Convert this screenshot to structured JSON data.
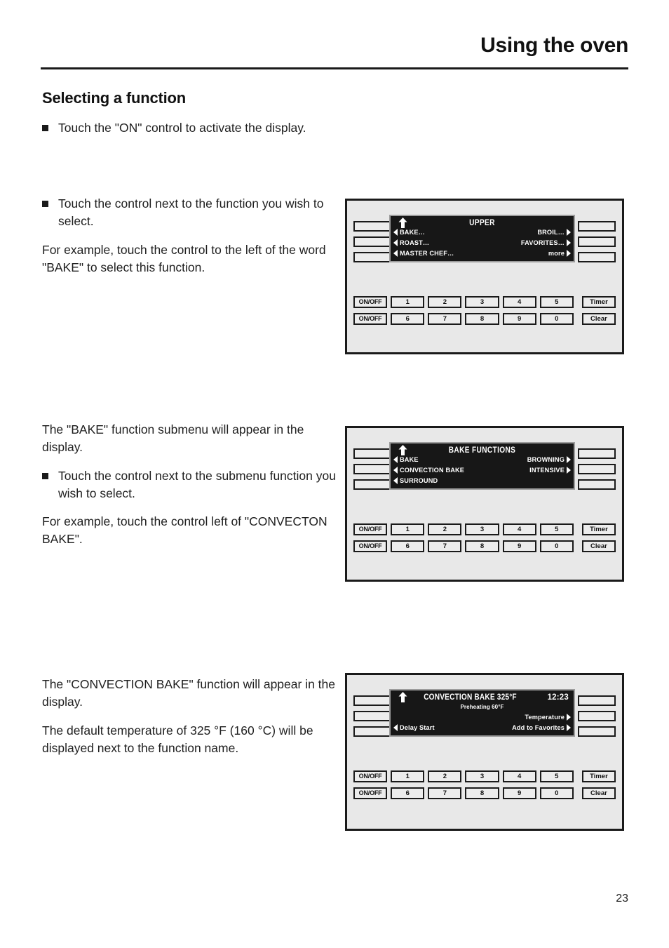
{
  "header": {
    "title": "Using the oven"
  },
  "section": {
    "heading": "Selecting a function"
  },
  "text_blocks": {
    "block1": {
      "bullet1": "Touch the \"ON\" control to activate the display."
    },
    "block2": {
      "bullet1": "Touch the control next to the function you wish to select.",
      "para1": "For example, touch the control to the left of the word \"BAKE\" to select this function."
    },
    "block3": {
      "para1": "The \"BAKE\" function submenu will appear in the display.",
      "bullet1": "Touch the control next to the submenu function you wish to select.",
      "para2": "For example, touch the control left of \"CONVECTON BAKE\"."
    },
    "block4": {
      "para1": "The \"CONVECTION BAKE\" function will appear in the display.",
      "para2": "The default temperature of 325 °F (160 °C) will be displayed next to the function name."
    }
  },
  "keypad": {
    "onoff_top": "ON/OFF",
    "onoff_bottom": "ON/OFF",
    "row_top": [
      "1",
      "2",
      "3",
      "4",
      "5"
    ],
    "row_bottom": [
      "6",
      "7",
      "8",
      "9",
      "0"
    ],
    "timer": "Timer",
    "clear": "Clear"
  },
  "ovens": {
    "panel1": {
      "lcd_title": "UPPER",
      "clock": "",
      "rows": [
        {
          "left": "BAKE…",
          "right": "BROIL…"
        },
        {
          "left": "ROAST…",
          "right": "FAVORITES…"
        },
        {
          "left": "MASTER CHEF…",
          "right": "more"
        }
      ]
    },
    "panel2": {
      "lcd_title": "BAKE FUNCTIONS",
      "clock": "",
      "rows": [
        {
          "left": "BAKE",
          "right": "BROWNING"
        },
        {
          "left": "CONVECTION BAKE",
          "right": "INTENSIVE"
        },
        {
          "left": "SURROUND",
          "right": ""
        }
      ]
    },
    "panel3": {
      "lcd_title": "CONVECTION BAKE 325°F",
      "clock": "12:23",
      "subtitle": "Preheating 60°F",
      "rows": [
        {
          "left": "",
          "right": ""
        },
        {
          "left": "",
          "right": "Temperature"
        },
        {
          "left": "Delay Start",
          "right": "Add to Favorites"
        }
      ]
    }
  },
  "footer": {
    "page_number": "23"
  },
  "colors": {
    "panel_bg": "#e8e8e8",
    "lcd_bg": "#171717",
    "lcd_fg": "#ffffff",
    "ink": "#1a1a1a"
  }
}
